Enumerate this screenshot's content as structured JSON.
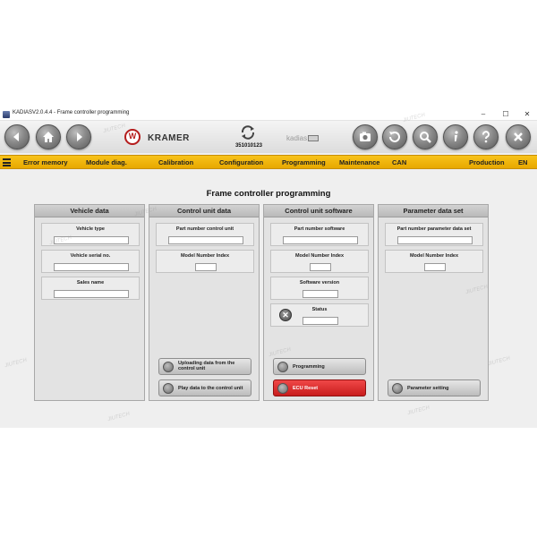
{
  "window": {
    "title": "KADIASV2.0.4.4 - Frame controller programming",
    "controls": {
      "minimize": "–",
      "maximize": "☐",
      "close": "✕"
    }
  },
  "toolbar": {
    "buttons": [
      "back-icon",
      "home-icon",
      "forward-icon",
      "camera-icon",
      "reload-icon",
      "search-icon",
      "info-icon",
      "help-icon",
      "close-icon"
    ],
    "brand_logo": "W",
    "brand_name": "KRAMER",
    "serial_number": "351010123",
    "kadias_logo": "kadias"
  },
  "menu": {
    "items": [
      "Error memory",
      "Module diag.",
      "Calibration",
      "Configuration",
      "Programming",
      "Maintenance",
      "CAN",
      "Production",
      "EN"
    ]
  },
  "page": {
    "title": "Frame controller programming"
  },
  "panels": {
    "vehicle_data": {
      "header": "Vehicle data",
      "fields": [
        "Vehicle type",
        "Vehicle serial no.",
        "Sales name"
      ]
    },
    "control_unit_data": {
      "header": "Control unit data",
      "fields": [
        "Part number control unit",
        "Model Number Index"
      ],
      "buttons": [
        "Uploading data from the control unit",
        "Play data to the control unit"
      ]
    },
    "control_unit_software": {
      "header": "Control unit software",
      "fields": [
        "Part number software",
        "Model Number Index",
        "Software version",
        "Status"
      ],
      "status_icon": "✕",
      "buttons": [
        "Programming",
        "ECU Reset"
      ]
    },
    "parameter_data_set": {
      "header": "Parameter data set",
      "fields": [
        "Part number parameter data set",
        "Model Number Index"
      ],
      "buttons": [
        "Parameter setting"
      ]
    }
  },
  "watermark": "JIUTECH",
  "colors": {
    "menu_bar": "#f0b80d",
    "ecu_reset": "#d92a2a",
    "panel_header": "#c4c4c4"
  }
}
